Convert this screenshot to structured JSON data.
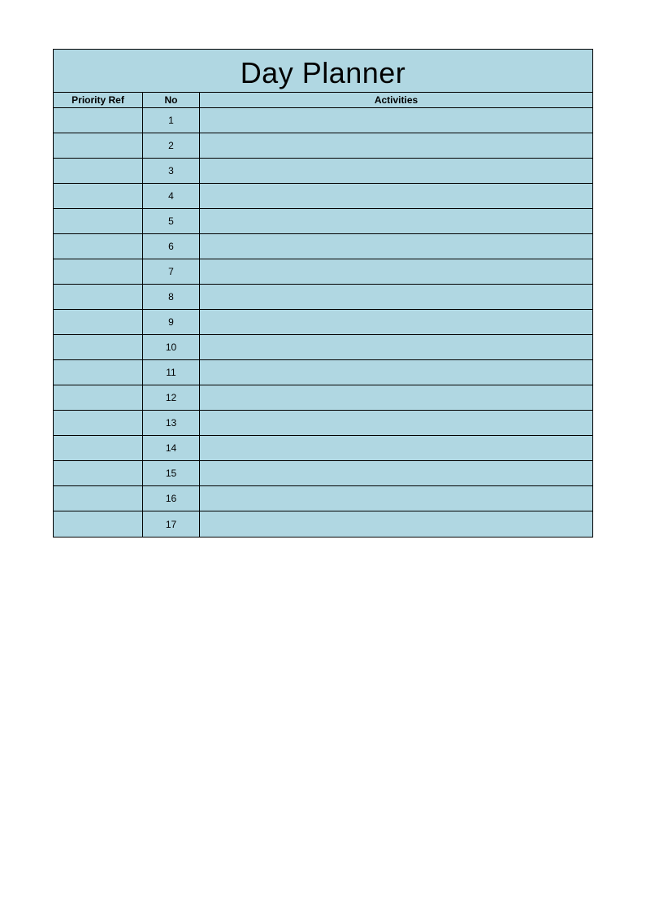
{
  "title": "Day Planner",
  "headers": {
    "priority_ref": "Priority Ref",
    "no": "No",
    "activities": "Activities"
  },
  "rows": [
    {
      "priority_ref": "",
      "no": "1",
      "activities": ""
    },
    {
      "priority_ref": "",
      "no": "2",
      "activities": ""
    },
    {
      "priority_ref": "",
      "no": "3",
      "activities": ""
    },
    {
      "priority_ref": "",
      "no": "4",
      "activities": ""
    },
    {
      "priority_ref": "",
      "no": "5",
      "activities": ""
    },
    {
      "priority_ref": "",
      "no": "6",
      "activities": ""
    },
    {
      "priority_ref": "",
      "no": "7",
      "activities": ""
    },
    {
      "priority_ref": "",
      "no": "8",
      "activities": ""
    },
    {
      "priority_ref": "",
      "no": "9",
      "activities": ""
    },
    {
      "priority_ref": "",
      "no": "10",
      "activities": ""
    },
    {
      "priority_ref": "",
      "no": "11",
      "activities": ""
    },
    {
      "priority_ref": "",
      "no": "12",
      "activities": ""
    },
    {
      "priority_ref": "",
      "no": "13",
      "activities": ""
    },
    {
      "priority_ref": "",
      "no": "14",
      "activities": ""
    },
    {
      "priority_ref": "",
      "no": "15",
      "activities": ""
    },
    {
      "priority_ref": "",
      "no": "16",
      "activities": ""
    },
    {
      "priority_ref": "",
      "no": "17",
      "activities": ""
    }
  ]
}
